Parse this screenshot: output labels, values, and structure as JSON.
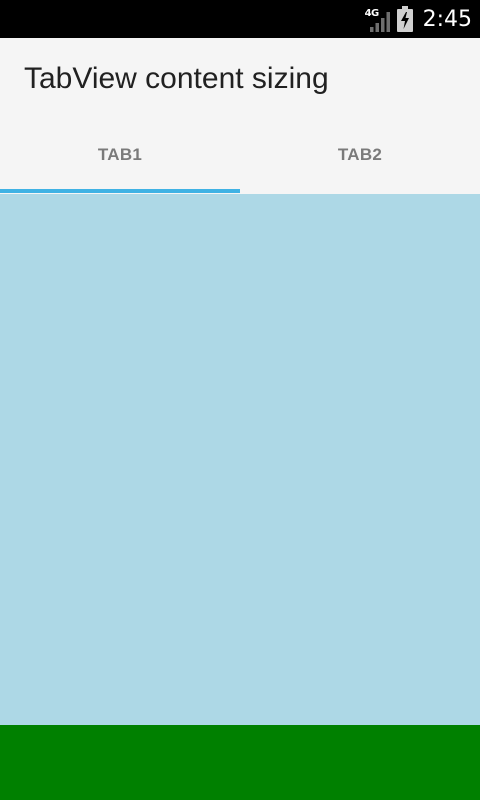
{
  "status_bar": {
    "network_type": "4G",
    "time": "2:45",
    "icons": [
      "signal-icon",
      "battery-charging-icon"
    ]
  },
  "app": {
    "title": "TabView content sizing"
  },
  "tabs": [
    {
      "label": "TAB1",
      "selected": true
    },
    {
      "label": "TAB2",
      "selected": false
    }
  ],
  "colors": {
    "status_bar": "#000000",
    "header": "#f5f5f5",
    "tab_indicator": "#3fb2e4",
    "tab_label": "#7a7a7a",
    "content": "#add8e6",
    "bottom_panel": "#008000"
  }
}
